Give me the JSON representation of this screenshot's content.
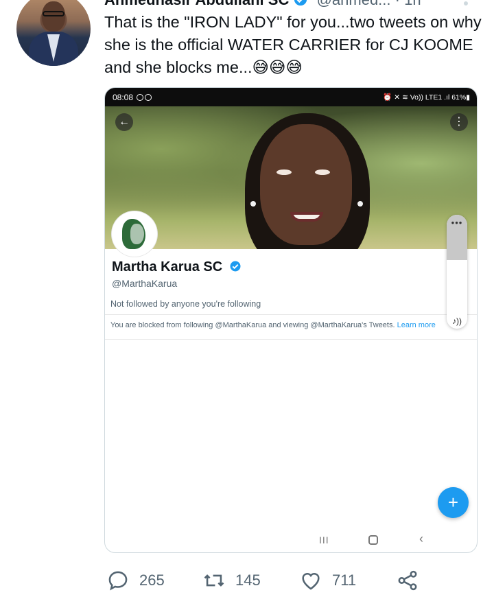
{
  "tweet": {
    "author_name": "Ahmednasir Abdullahi SC",
    "handle": "@ahmed...",
    "time": "· 1h",
    "text": "That is the \"IRON LADY\" for you...two tweets on why she is the official WATER CARRIER for CJ KOOME and she blocks me...😅😅😅",
    "verified_color": "#1d9bf0"
  },
  "screenshot": {
    "status_time": "08:08",
    "status_right": "⏰ ✕ ≋ Vo)) LTE1 .ıl 61%▮",
    "profile": {
      "name": "Martha Karua SC",
      "handle": "@MarthaKarua",
      "followers_note": "Not followed by anyone you're following",
      "blocked_text": "You are blocked from following @MarthaKarua and viewing @MarthaKarua's Tweets.",
      "learn_more": "Learn more"
    },
    "back_icon": "←",
    "more_icon": "⋮",
    "scroll_dots": "•••",
    "music_icon": "♪))",
    "fab_icon": "+",
    "nav_recent": "III",
    "nav_back": "‹"
  },
  "actions": {
    "replies": "265",
    "retweets": "145",
    "likes": "711"
  },
  "colors": {
    "accent": "#1d9bf0",
    "text": "#0f1419",
    "secondary": "#536471"
  }
}
